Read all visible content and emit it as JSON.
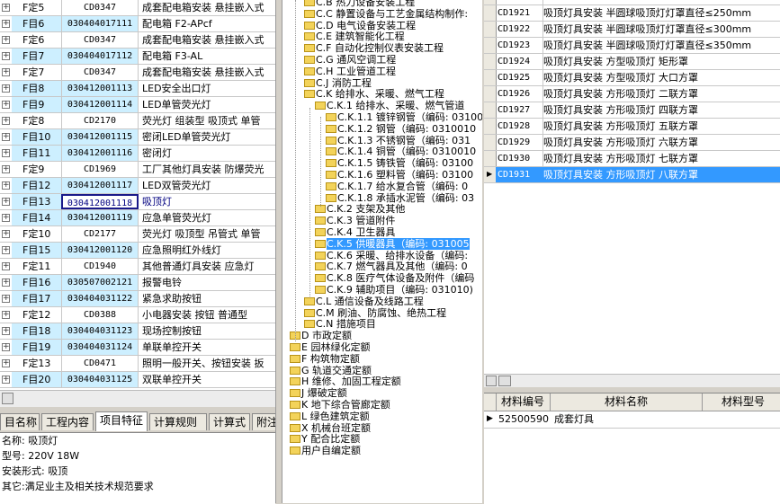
{
  "left_grid": {
    "rows": [
      {
        "id": "F定5",
        "code": "CD0347",
        "name": "成套配电箱安装 悬挂嵌入式",
        "type": "c"
      },
      {
        "id": "F目6",
        "code": "030404017111",
        "name": "配电箱 F2-APcf",
        "type": "f"
      },
      {
        "id": "F定6",
        "code": "CD0347",
        "name": "成套配电箱安装 悬挂嵌入式",
        "type": "c"
      },
      {
        "id": "F目7",
        "code": "030404017112",
        "name": "配电箱 F3-AL",
        "type": "f"
      },
      {
        "id": "F定7",
        "code": "CD0347",
        "name": "成套配电箱安装 悬挂嵌入式",
        "type": "c"
      },
      {
        "id": "F目8",
        "code": "030412001113",
        "name": "LED安全出口灯",
        "type": "f"
      },
      {
        "id": "F目9",
        "code": "030412001114",
        "name": "LED单管荧光灯",
        "type": "f"
      },
      {
        "id": "F定8",
        "code": "CD2170",
        "name": "荧光灯 组装型 吸顶式 单管",
        "type": "c"
      },
      {
        "id": "F目10",
        "code": "030412001115",
        "name": "密闭LED单管荧光灯",
        "type": "f"
      },
      {
        "id": "F目11",
        "code": "030412001116",
        "name": "密闭灯",
        "type": "f"
      },
      {
        "id": "F定9",
        "code": "CD1969",
        "name": "工厂其他灯具安装 防爆荧光",
        "type": "c"
      },
      {
        "id": "F目12",
        "code": "030412001117",
        "name": "LED双管荧光灯",
        "type": "f"
      },
      {
        "id": "F目13",
        "code": "030412001118",
        "name": "吸顶灯",
        "type": "f",
        "selected": true
      },
      {
        "id": "F目14",
        "code": "030412001119",
        "name": "应急单管荧光灯",
        "type": "f"
      },
      {
        "id": "F定10",
        "code": "CD2177",
        "name": "荧光灯 吸顶型 吊管式 单管",
        "type": "c"
      },
      {
        "id": "F目15",
        "code": "030412001120",
        "name": "应急照明红外线灯",
        "type": "f"
      },
      {
        "id": "F定11",
        "code": "CD1940",
        "name": "其他普通灯具安装 应急灯",
        "type": "c"
      },
      {
        "id": "F目16",
        "code": "030507002121",
        "name": "报警电铃",
        "type": "f"
      },
      {
        "id": "F目17",
        "code": "030404031122",
        "name": "紧急求助按钮",
        "type": "f"
      },
      {
        "id": "F定12",
        "code": "CD0388",
        "name": "小电器安装 按钮 普通型",
        "type": "c"
      },
      {
        "id": "F目18",
        "code": "030404031123",
        "name": "现场控制按钮",
        "type": "f"
      },
      {
        "id": "F目19",
        "code": "030404031124",
        "name": "单联单控开关",
        "type": "f"
      },
      {
        "id": "F定13",
        "code": "CD0471",
        "name": "照明一般开关、按钮安装 扳",
        "type": "c"
      },
      {
        "id": "F目20",
        "code": "030404031125",
        "name": "双联单控开关",
        "type": "f"
      }
    ]
  },
  "tabs": [
    "目名称",
    "工程内容",
    "项目特征",
    "计算规则",
    "计算式",
    "附注"
  ],
  "active_tab": 2,
  "features": [
    "名称: 吸顶灯",
    "型号: 220V 18W",
    "安装形式: 吸顶",
    "其它:满足业主及相关技术规范要求"
  ],
  "tree": {
    "items": [
      {
        "label": "C.B 热力设备安装工程",
        "depth": 1
      },
      {
        "label": "C.C 静置设备与工艺金属结构制作:",
        "depth": 1
      },
      {
        "label": "C.D 电气设备安装工程",
        "depth": 1
      },
      {
        "label": "C.E 建筑智能化工程",
        "depth": 1
      },
      {
        "label": "C.F 自动化控制仪表安装工程",
        "depth": 1
      },
      {
        "label": "C.G 通风空调工程",
        "depth": 1
      },
      {
        "label": "C.H 工业管道工程",
        "depth": 1
      },
      {
        "label": "C.J 消防工程",
        "depth": 1
      },
      {
        "label": "C.K 给排水、采暖、燃气工程",
        "depth": 1
      },
      {
        "label": "C.K.1 给排水、采暖、燃气管道",
        "depth": 2
      },
      {
        "label": "C.K.1.1 镀锌钢管（编码: 031001",
        "depth": 3
      },
      {
        "label": "C.K.1.2 钢管（编码: 0310010",
        "depth": 3
      },
      {
        "label": "C.K.1.3 不锈钢管（编码: 031",
        "depth": 3
      },
      {
        "label": "C.K.1.4 铜管（编码: 0310010",
        "depth": 3
      },
      {
        "label": "C.K.1.5 铸铁管（编码: 03100",
        "depth": 3
      },
      {
        "label": "C.K.1.6 塑料管（编码: 03100",
        "depth": 3
      },
      {
        "label": "C.K.1.7 给水复合管（编码: 0",
        "depth": 3
      },
      {
        "label": "C.K.1.8 承插水泥管（编码: 03",
        "depth": 3
      },
      {
        "label": "C.K.2 支架及其他",
        "depth": 2
      },
      {
        "label": "C.K.3 管道附件",
        "depth": 2
      },
      {
        "label": "C.K.4 卫生器具",
        "depth": 2
      },
      {
        "label": "C.K.5 供暖器具（编码: 031005",
        "depth": 2,
        "selected": true
      },
      {
        "label": "C.K.6 采暖、给排水设备（编码:",
        "depth": 2
      },
      {
        "label": "C.K.7 燃气器具及其他（编码: 0",
        "depth": 2
      },
      {
        "label": "C.K.8 医疗气体设备及附件（编码",
        "depth": 2
      },
      {
        "label": "C.K.9 辅助项目（编码: 031010)",
        "depth": 2
      },
      {
        "label": "C.L 通信设备及线路工程",
        "depth": 1
      },
      {
        "label": "C.M 刷油、防腐蚀、绝热工程",
        "depth": 1
      },
      {
        "label": "C.N 措施项目",
        "depth": 1
      },
      {
        "label": "D 市政定额",
        "depth": 0
      },
      {
        "label": "E 园林绿化定额",
        "depth": 0
      },
      {
        "label": "F 构筑物定额",
        "depth": 0
      },
      {
        "label": "G 轨道交通定额",
        "depth": 0
      },
      {
        "label": "H 维修、加固工程定额",
        "depth": 0
      },
      {
        "label": "J 爆破定额",
        "depth": 0
      },
      {
        "label": "K 地下综合管廊定额",
        "depth": 0
      },
      {
        "label": "L 绿色建筑定额",
        "depth": 0
      },
      {
        "label": "X 机械台班定额",
        "depth": 0
      },
      {
        "label": "Y 配合比定额",
        "depth": 0
      },
      {
        "label": "用户自编定额",
        "depth": 0
      }
    ]
  },
  "right_grid": {
    "rows": [
      {
        "code": "",
        "name": ""
      },
      {
        "code": "CD1921",
        "name": "吸顶灯具安装 半圆球吸顶灯灯罩直径≤250mm"
      },
      {
        "code": "CD1922",
        "name": "吸顶灯具安装 半圆球吸顶灯灯罩直径≤300mm"
      },
      {
        "code": "CD1923",
        "name": "吸顶灯具安装 半圆球吸顶灯灯罩直径≤350mm"
      },
      {
        "code": "CD1924",
        "name": "吸顶灯具安装 方型吸顶灯 矩形罩"
      },
      {
        "code": "CD1925",
        "name": "吸顶灯具安装 方型吸顶灯 大口方罩"
      },
      {
        "code": "CD1926",
        "name": "吸顶灯具安装 方形吸顶灯 二联方罩"
      },
      {
        "code": "CD1927",
        "name": "吸顶灯具安装 方形吸顶灯 四联方罩"
      },
      {
        "code": "CD1928",
        "name": "吸顶灯具安装 方形吸顶灯 五联方罩"
      },
      {
        "code": "CD1929",
        "name": "吸顶灯具安装 方形吸顶灯 六联方罩"
      },
      {
        "code": "CD1930",
        "name": "吸顶灯具安装 方形吸顶灯 七联方罩"
      },
      {
        "code": "CD1931",
        "name": "吸顶灯具安装 方形吸顶灯 八联方罩",
        "selected": true
      }
    ]
  },
  "materials": {
    "headers": [
      "材料编号",
      "材料名称",
      "材料型号"
    ],
    "rows": [
      {
        "code": "52500590",
        "name": "成套灯具",
        "model": ""
      }
    ]
  }
}
